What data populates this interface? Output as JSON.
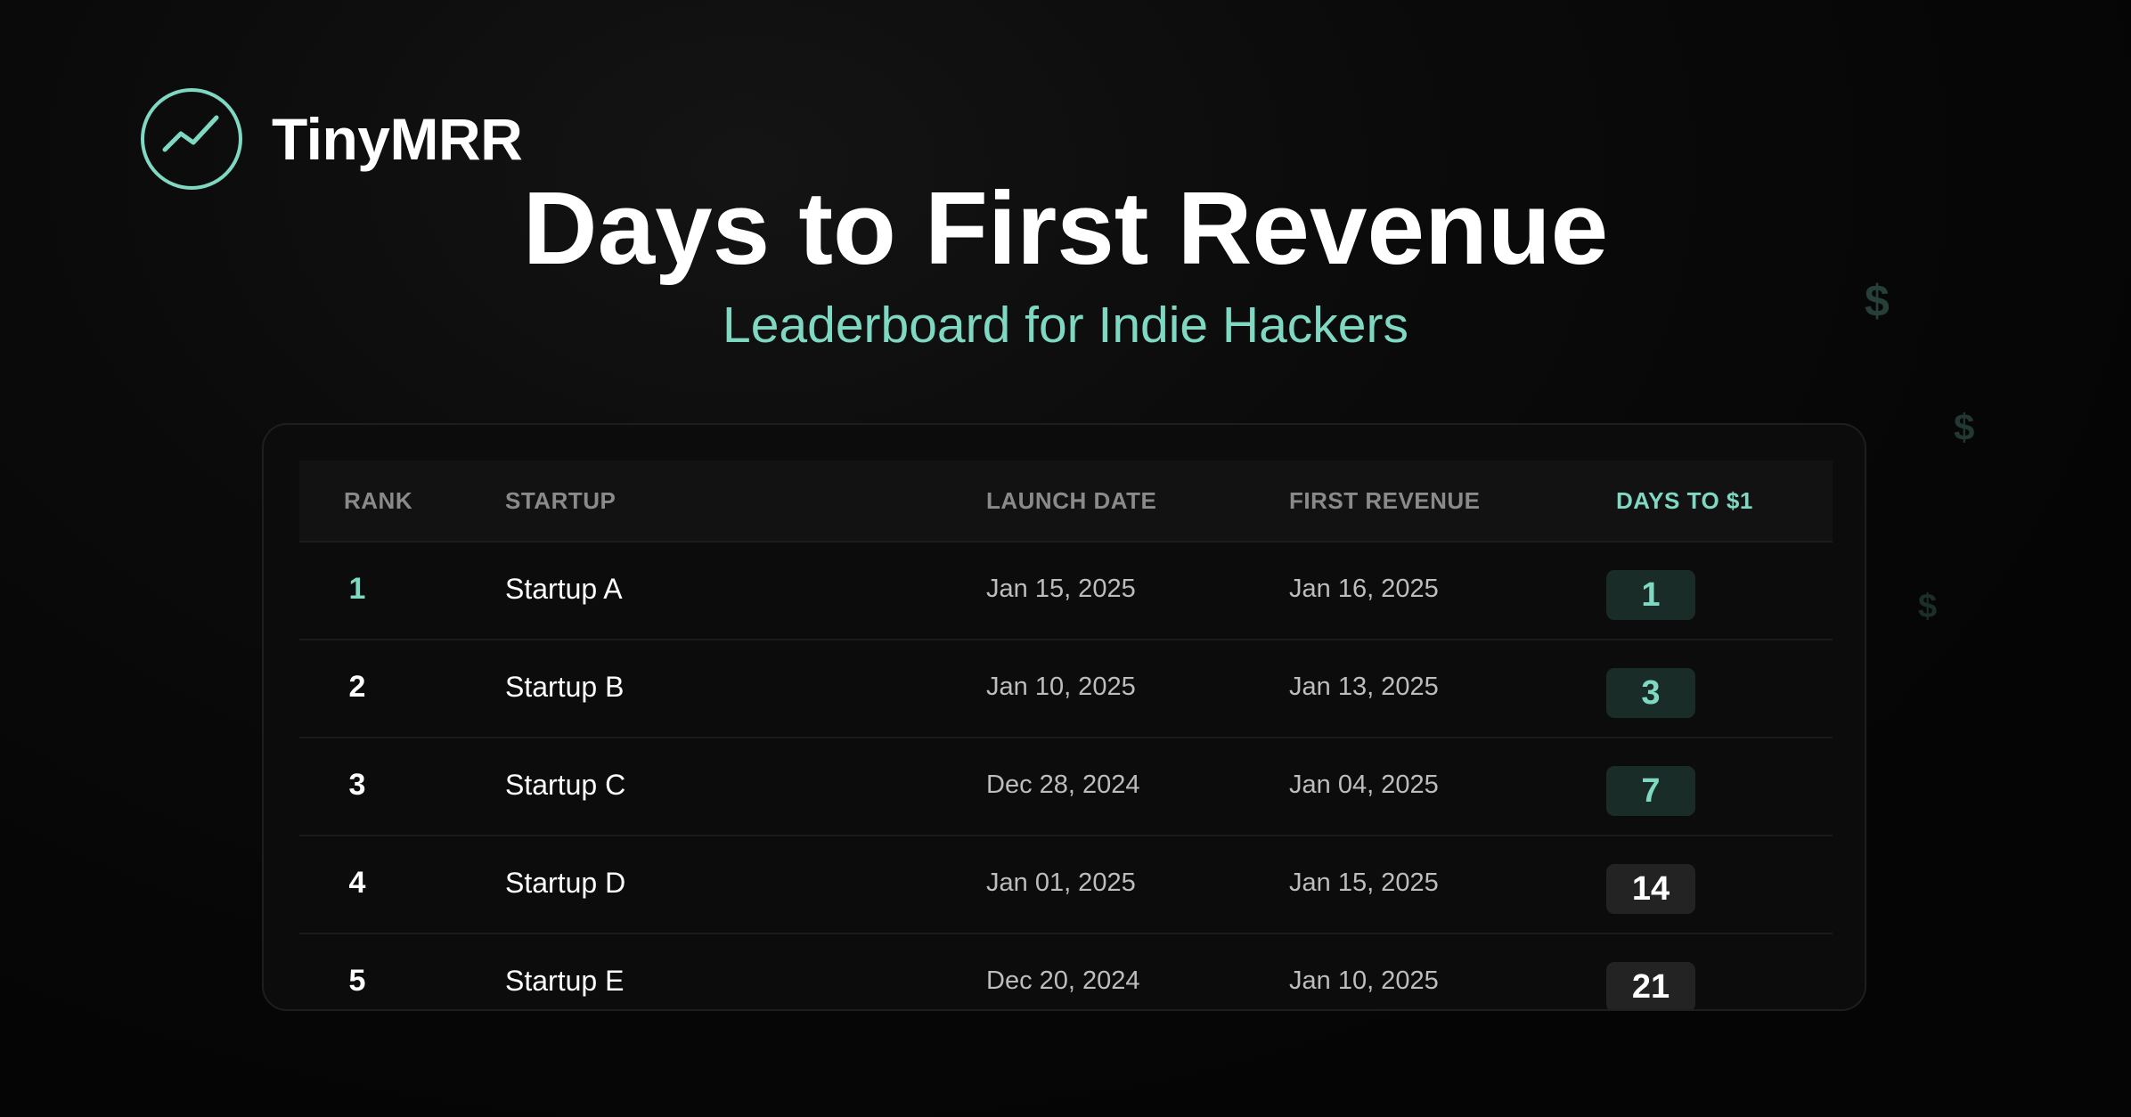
{
  "brand": {
    "name": "TinyMRR",
    "icon": "trend-line-icon",
    "accent_color": "#7fd8c2"
  },
  "header": {
    "title": "Days to First Revenue",
    "subtitle": "Leaderboard for Indie Hackers"
  },
  "decorations": {
    "dollar_symbol": "$"
  },
  "leaderboard": {
    "columns": {
      "rank": "RANK",
      "startup": "STARTUP",
      "launch_date": "LAUNCH DATE",
      "first_revenue": "FIRST REVENUE",
      "days": "DAYS TO $1"
    },
    "rows": [
      {
        "rank": "1",
        "startup": "Startup A",
        "launch_date": "Jan 15, 2025",
        "first_revenue": "Jan 16, 2025",
        "days": "1"
      },
      {
        "rank": "2",
        "startup": "Startup B",
        "launch_date": "Jan 10, 2025",
        "first_revenue": "Jan 13, 2025",
        "days": "3"
      },
      {
        "rank": "3",
        "startup": "Startup C",
        "launch_date": "Dec 28, 2024",
        "first_revenue": "Jan 04, 2025",
        "days": "7"
      },
      {
        "rank": "4",
        "startup": "Startup D",
        "launch_date": "Jan 01, 2025",
        "first_revenue": "Jan 15, 2025",
        "days": "14"
      },
      {
        "rank": "5",
        "startup": "Startup E",
        "launch_date": "Dec 20, 2024",
        "first_revenue": "Jan 10, 2025",
        "days": "21"
      }
    ]
  }
}
